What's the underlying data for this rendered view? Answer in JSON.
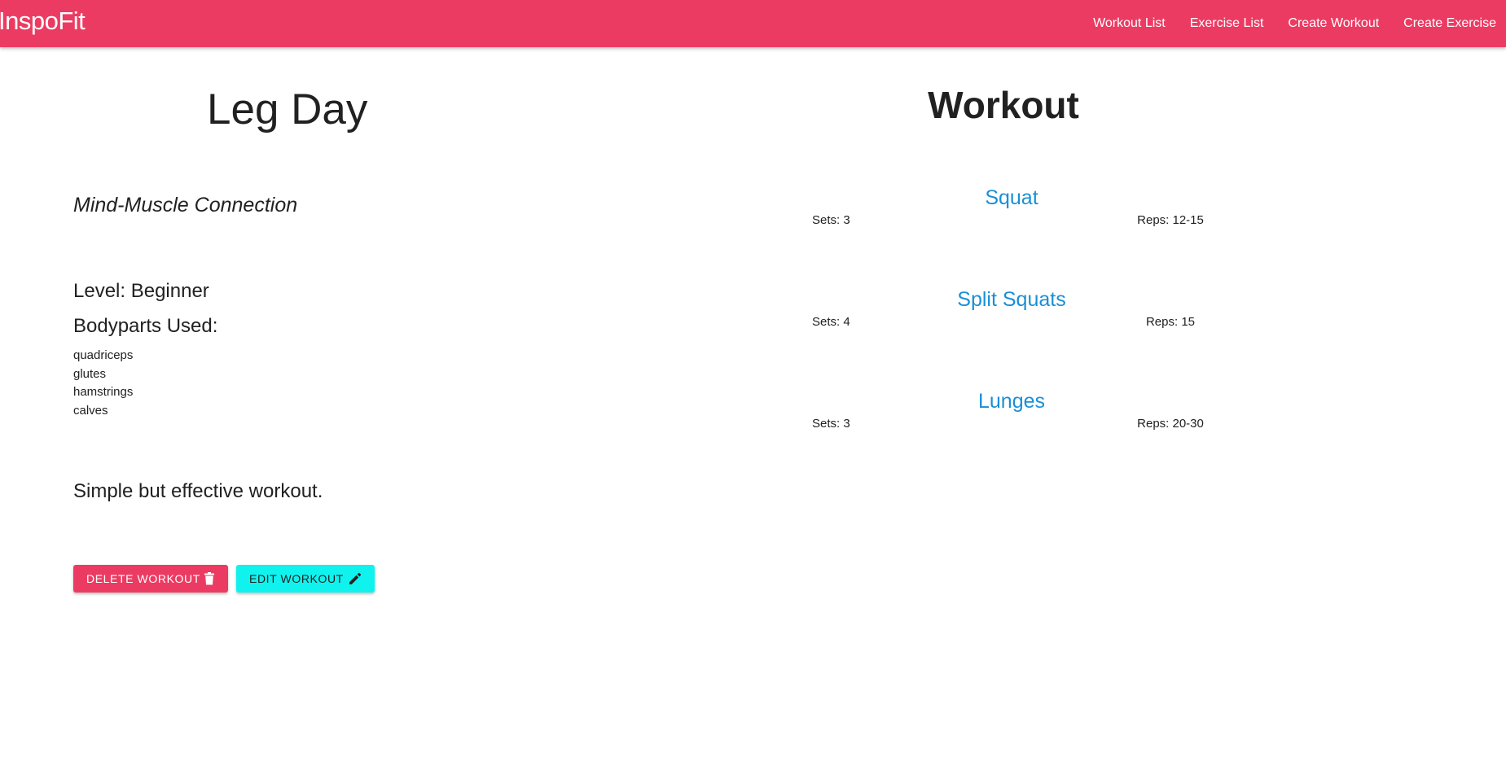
{
  "navbar": {
    "brand": "InspoFit",
    "links": [
      {
        "label": "Workout List"
      },
      {
        "label": "Exercise List"
      },
      {
        "label": "Create Workout"
      },
      {
        "label": "Create Exercise"
      }
    ],
    "color": "#ec3b62"
  },
  "workout": {
    "name": "Leg Day",
    "type": "Mind-Muscle Connection",
    "level_label": "Level:",
    "level": "Beginner",
    "bodyparts_heading": "Bodyparts Used:",
    "bodyparts": [
      "quadriceps",
      "glutes",
      "hamstrings",
      "calves"
    ],
    "description": "Simple but effective workout."
  },
  "actions": {
    "delete_label": "DELETE WORKOUT",
    "delete_icon": "trash-icon",
    "delete_color": "#ec3b62",
    "edit_label": "EDIT WORKOUT",
    "edit_icon": "pencil-icon",
    "edit_color": "#10f2ee"
  },
  "exercises_section": {
    "title": "Workout",
    "link_color": "#1a8fd6",
    "exercises": [
      {
        "name": "Squat",
        "sets": "Sets: 3",
        "reps": "Reps: 12-15"
      },
      {
        "name": "Split Squats",
        "sets": "Sets: 4",
        "reps": "Reps: 15"
      },
      {
        "name": "Lunges",
        "sets": "Sets: 3",
        "reps": "Reps: 20-30"
      }
    ]
  }
}
